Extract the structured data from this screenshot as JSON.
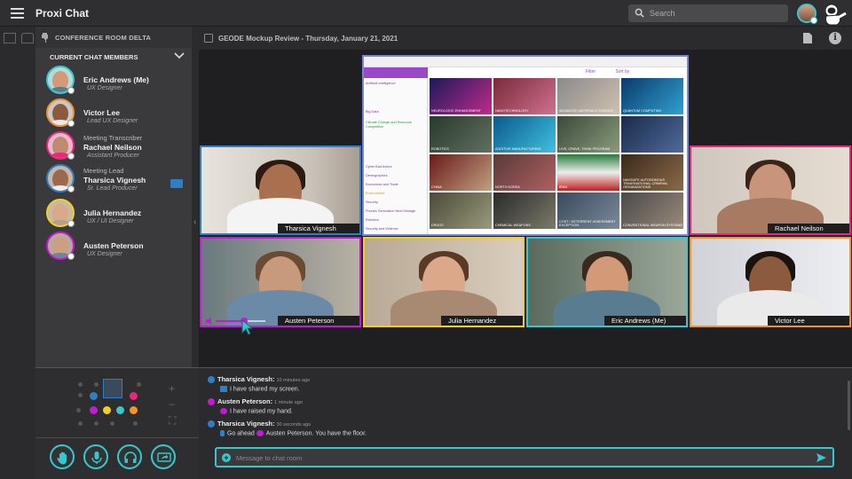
{
  "app": {
    "title": "Proxi Chat"
  },
  "search": {
    "placeholder": "Search"
  },
  "sidebar": {
    "room": "CONFERENCE ROOM DELTA",
    "members_header": "CURRENT CHAT MEMBERS",
    "members": [
      {
        "role": "",
        "name": "Eric Andrews (Me)",
        "title": "UX Designer",
        "color": "#36c8cf"
      },
      {
        "role": "",
        "name": "Victor Lee",
        "title": "Lead UX Designer",
        "color": "#f5922b"
      },
      {
        "role": "Meeting Transcriber",
        "name": "Rachael Neilson",
        "title": "Assistant Producer",
        "color": "#e8287a"
      },
      {
        "role": "Meeting Lead",
        "name": "Tharsica Vignesh",
        "title": "Sr. Lead Producer",
        "color": "#2f7fc8"
      },
      {
        "role": "",
        "name": "Julia Hernandez",
        "title": "UX / UI Designer",
        "color": "#f2d01e"
      },
      {
        "role": "",
        "name": "Austen Peterson",
        "title": "UX Designer",
        "color": "#c41ad6"
      }
    ]
  },
  "meeting": {
    "title": "GEODE Mockup Review - Thursday, January 21, 2021"
  },
  "tiles": [
    {
      "name": "Tharsica Vignesh",
      "color": "#2f7fc8"
    },
    {
      "name": "Rachael Neilson",
      "color": "#e8287a"
    },
    {
      "name": "Austen Peterson",
      "color": "#c41ad6"
    },
    {
      "name": "Julia Hernandez",
      "color": "#f2d01e"
    },
    {
      "name": "Eric Andrews (Me)",
      "color": "#36c8cf"
    },
    {
      "name": "Victor Lee",
      "color": "#f5922b"
    }
  ],
  "screenshare": {
    "filter_label": "Filter",
    "sort_label": "Sort by",
    "categories": [
      "Artificial Intelligence",
      "Big Data",
      "Climate Change and Resource Competition",
      "Cyber Bad Actors",
      "Demographics",
      "Economics and Trade",
      "Environment",
      "Security",
      "Proxies Generation Next Manage",
      "Robotics",
      "Security and Violence"
    ],
    "tiles": [
      "Neurologic Enhancement",
      "Nanotechnology",
      "Advanced Materials Science",
      "Quantum Computing",
      "Robotics",
      "Additive Manufacturing",
      "Live, Crave, Think Program",
      "",
      "China",
      "North Korea",
      "Iran",
      "Navigate Autonomous Transnational Criminal Organizations",
      "Drugs",
      "Chemical Weapons",
      "Cost / Deterrent Assessment Exception",
      "Conventional Weapon Systems"
    ]
  },
  "chat": {
    "messages": [
      {
        "sender": "Tharsica Vignesh:",
        "time": "10 minutes ago",
        "text": "I have shared my screen.",
        "color": "#2f7fc8"
      },
      {
        "sender": "Austen Peterson:",
        "time": "1 minute ago",
        "text": "I have raised my hand.",
        "color": "#c41ad6"
      },
      {
        "sender": "Tharsica Vignesh:",
        "time": "30 seconds ago",
        "text": "Go ahead",
        "mention": "Austen Peterson. You have the floor.",
        "color": "#2f7fc8"
      }
    ],
    "input_placeholder": "Message to chat room"
  },
  "colors": {
    "accent": "#36c8cf"
  }
}
